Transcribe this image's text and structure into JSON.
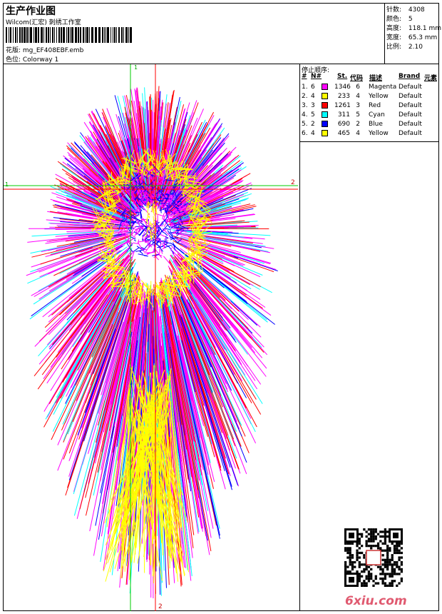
{
  "header": {
    "title": "生产作业图",
    "subtitle": "Wilcom(汇宏) 刺绣工作室",
    "design": "花版: mg_EF408EBF.emb",
    "colorway": "色位: Colorway 1"
  },
  "stats": [
    {
      "label": "针数:",
      "value": "4308"
    },
    {
      "label": "颜色:",
      "value": "5"
    },
    {
      "label": "高度:",
      "value": "118.1 mm"
    },
    {
      "label": "宽度:",
      "value": "65.3 mm"
    },
    {
      "label": "比例:",
      "value": "2.10"
    }
  ],
  "stop_sequence": {
    "title": "停止顺序:",
    "headers": [
      "#",
      "N#",
      "St.",
      "代码",
      "描述",
      "Brand",
      "元素"
    ],
    "rows": [
      {
        "seq": "1.",
        "n": "6",
        "color": "#ff00ff",
        "st": "1346",
        "code": "6",
        "desc": "Magenta",
        "brand": "Default"
      },
      {
        "seq": "2.",
        "n": "4",
        "color": "#ffff00",
        "st": "233",
        "code": "4",
        "desc": "Yellow",
        "brand": "Default"
      },
      {
        "seq": "3.",
        "n": "3",
        "color": "#ff0000",
        "st": "1261",
        "code": "3",
        "desc": "Red",
        "brand": "Default"
      },
      {
        "seq": "4.",
        "n": "5",
        "color": "#00ffff",
        "st": "311",
        "code": "5",
        "desc": "Cyan",
        "brand": "Default"
      },
      {
        "seq": "5.",
        "n": "2",
        "color": "#0000ff",
        "st": "690",
        "code": "2",
        "desc": "Blue",
        "brand": "Default"
      },
      {
        "seq": "6.",
        "n": "4",
        "color": "#ffff00",
        "st": "465",
        "code": "4",
        "desc": "Yellow",
        "brand": "Default"
      }
    ]
  },
  "guides": {
    "g1": "1",
    "g2": "2"
  },
  "watermark": "6xiu.com",
  "thread_colors": [
    "#ff00ff",
    "#ffff00",
    "#ff0000",
    "#00ffff",
    "#0000ff"
  ]
}
